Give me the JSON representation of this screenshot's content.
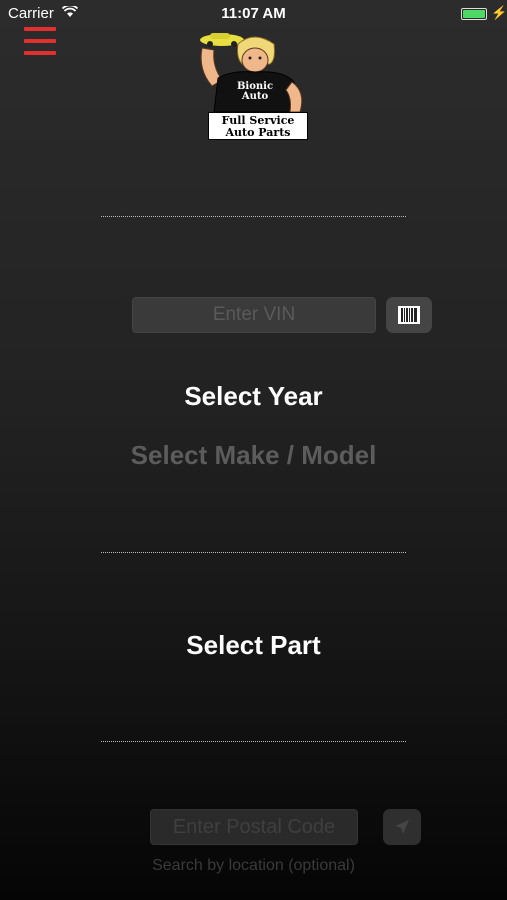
{
  "status_bar": {
    "carrier": "Carrier",
    "time": "11:07 AM"
  },
  "logo": {
    "brand_line1": "Bionic",
    "brand_line2": "Auto",
    "tagline_line1": "Full Service",
    "tagline_line2": "Auto Parts"
  },
  "vin": {
    "placeholder": "Enter VIN"
  },
  "selectors": {
    "year": "Select Year",
    "make_model": "Select Make / Model",
    "part": "Select Part"
  },
  "location": {
    "postal_placeholder": "Enter Postal Code",
    "hint": "Search by location (optional)"
  },
  "colors": {
    "menu_accent": "#e03030",
    "battery": "#4cd964"
  }
}
